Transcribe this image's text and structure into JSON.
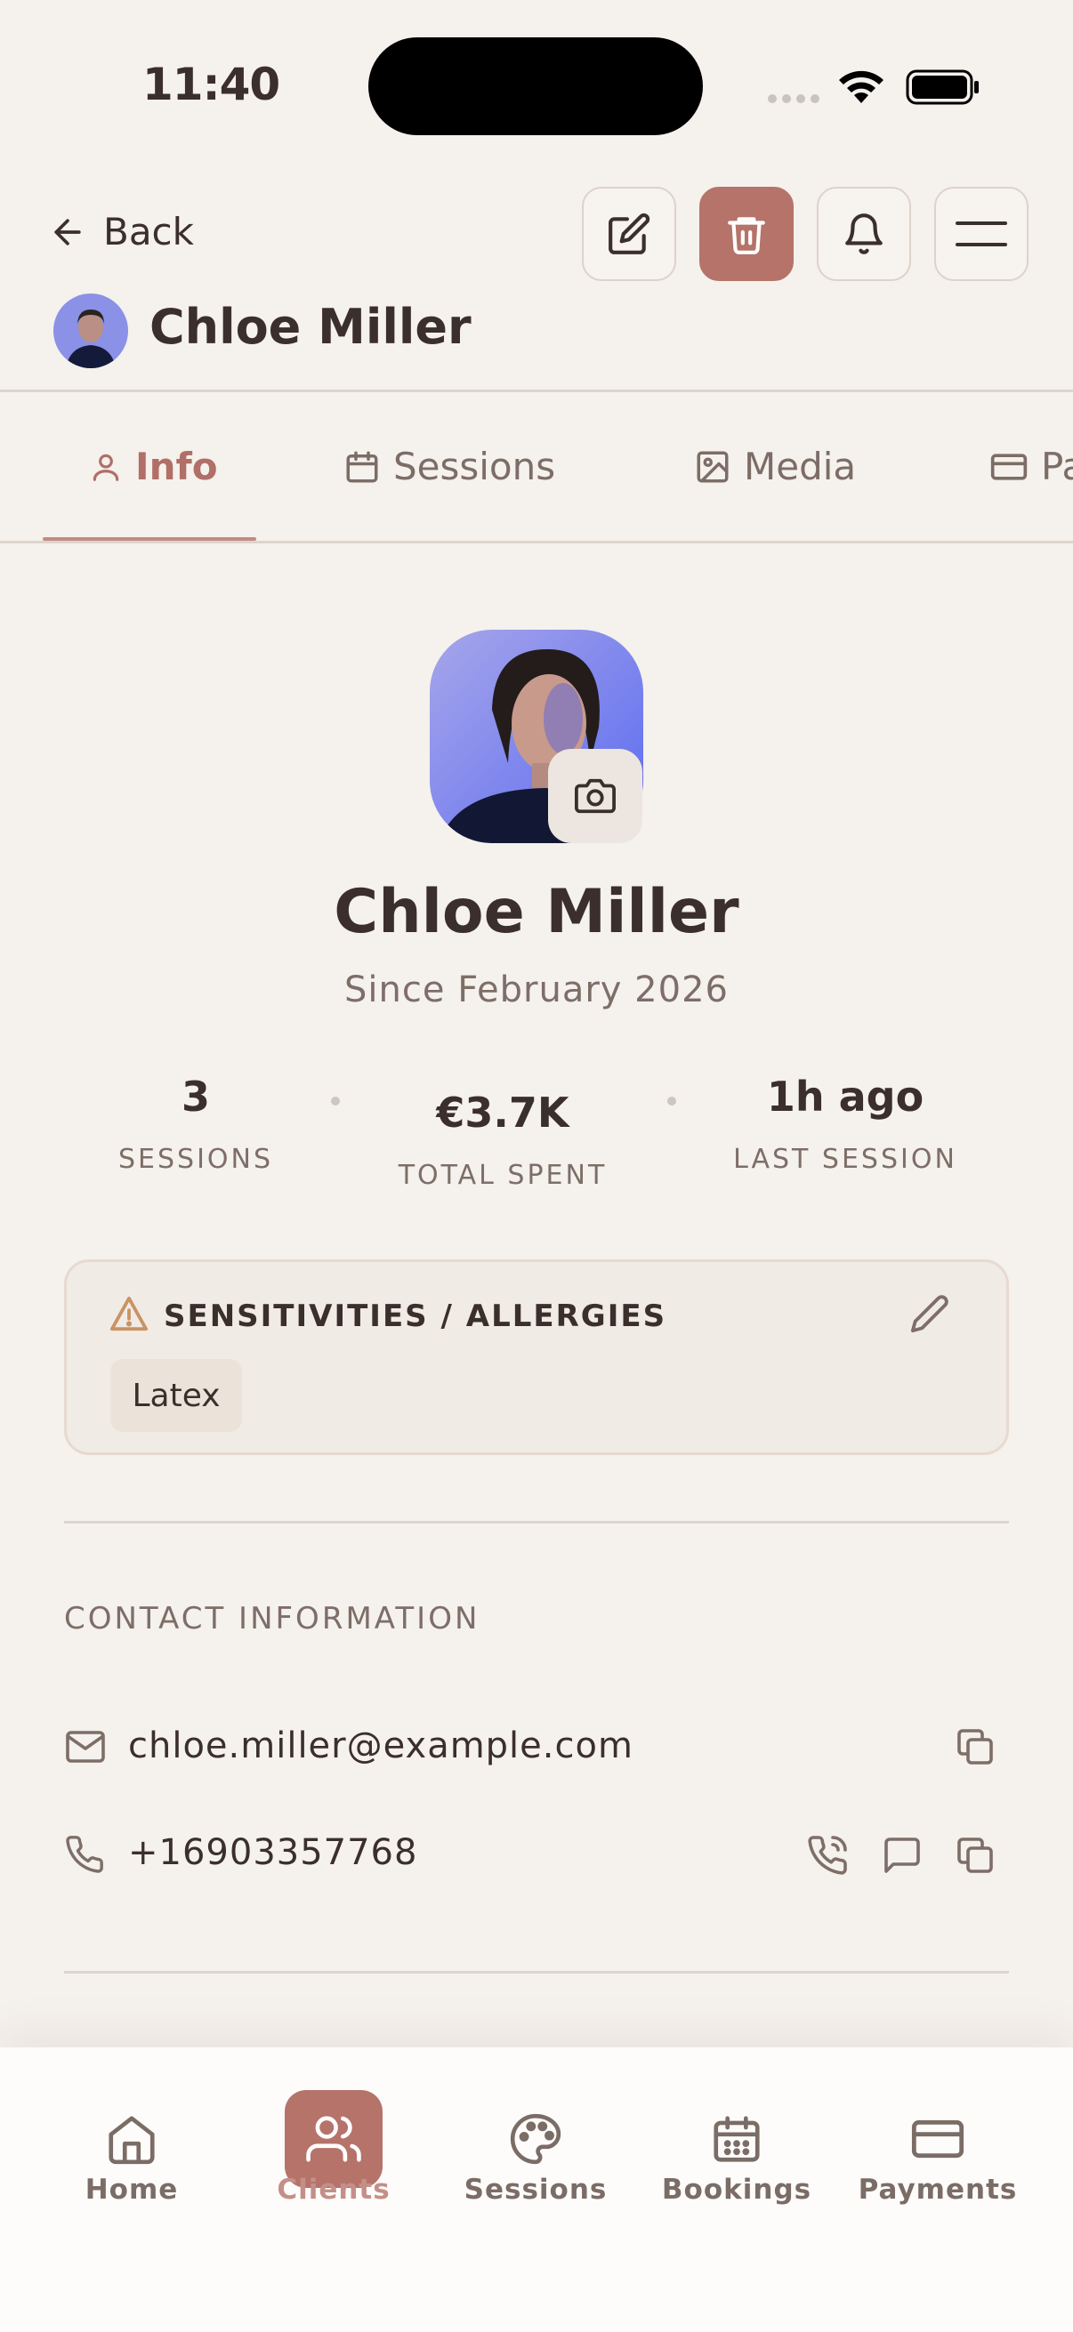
{
  "status_bar": {
    "time": "11:40"
  },
  "header": {
    "back_label": "Back",
    "client_name": "Chloe Miller"
  },
  "tabs": [
    {
      "label": "Info",
      "icon": "user-icon"
    },
    {
      "label": "Sessions",
      "icon": "calendar-icon"
    },
    {
      "label": "Media",
      "icon": "image-icon"
    },
    {
      "label": "Pa",
      "icon": "card-icon"
    }
  ],
  "profile": {
    "name": "Chloe Miller",
    "since": "Since February 2026"
  },
  "stats": [
    {
      "value": "3",
      "label": "SESSIONS"
    },
    {
      "value": "€3.7K",
      "label": "TOTAL SPENT"
    },
    {
      "value": "1h ago",
      "label": "LAST SESSION"
    }
  ],
  "allergies": {
    "title": "SENSITIVITIES / ALLERGIES",
    "items": [
      "Latex"
    ]
  },
  "contact": {
    "title": "CONTACT INFORMATION",
    "email": "chloe.miller@example.com",
    "phone": "+16903357768"
  },
  "bottom_nav": [
    {
      "label": "Home",
      "icon": "home-icon"
    },
    {
      "label": "Clients",
      "icon": "users-icon",
      "active": true
    },
    {
      "label": "Sessions",
      "icon": "palette-icon"
    },
    {
      "label": "Bookings",
      "icon": "calendar-grid-icon"
    },
    {
      "label": "Payments",
      "icon": "credit-card-icon"
    }
  ],
  "colors": {
    "accent": "#b5736a",
    "background": "#f5f1ec",
    "text": "#3b2f2b",
    "muted": "#7d6e67"
  }
}
